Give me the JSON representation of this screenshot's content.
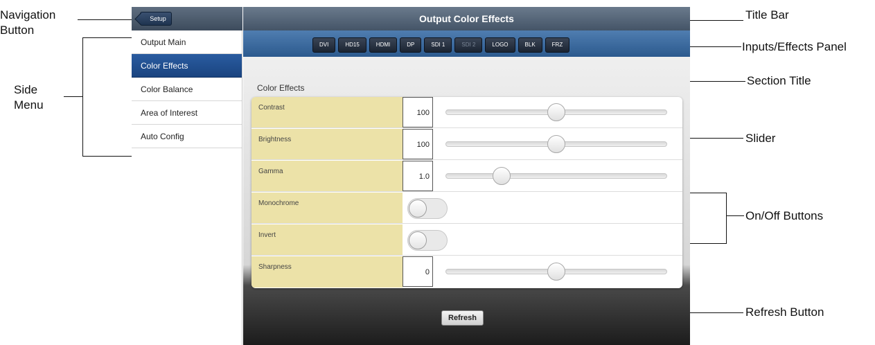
{
  "app": {
    "nav_button": "Setup",
    "title": "Output Color Effects"
  },
  "sidebar": {
    "items": [
      {
        "label": "Output Main",
        "active": false
      },
      {
        "label": "Color Effects",
        "active": true
      },
      {
        "label": "Color Balance",
        "active": false
      },
      {
        "label": "Area of Interest",
        "active": false
      },
      {
        "label": "Auto Config",
        "active": false
      }
    ]
  },
  "tabs": [
    {
      "label": "DVI",
      "enabled": true
    },
    {
      "label": "HD15",
      "enabled": true
    },
    {
      "label": "HDMI",
      "enabled": true
    },
    {
      "label": "DP",
      "enabled": true
    },
    {
      "label": "SDI 1",
      "enabled": true
    },
    {
      "label": "SDI 2",
      "enabled": false
    },
    {
      "label": "LOGO",
      "enabled": true
    },
    {
      "label": "BLK",
      "enabled": true
    },
    {
      "label": "FRZ",
      "enabled": true
    }
  ],
  "section": {
    "title": "Color Effects",
    "rows": [
      {
        "label": "Contrast",
        "kind": "slider",
        "value": "100",
        "level": 0.5
      },
      {
        "label": "Brightness",
        "kind": "slider",
        "value": "100",
        "level": 0.5
      },
      {
        "label": "Gamma",
        "kind": "slider",
        "value": "1.0",
        "level": 0.25
      },
      {
        "label": "Monochrome",
        "kind": "toggle",
        "on": false
      },
      {
        "label": "Invert",
        "kind": "toggle",
        "on": false
      },
      {
        "label": "Sharpness",
        "kind": "slider",
        "value": "0",
        "level": 0.5
      }
    ],
    "refresh_label": "Refresh"
  },
  "callouts": {
    "nav_line1": "Navigation",
    "nav_line2": "Button",
    "side_line1": "Side",
    "side_line2": "Menu",
    "title_bar": "Title Bar",
    "inputs_panel": "Inputs/Effects Panel",
    "section_title": "Section Title",
    "slider": "Slider",
    "onoff": "On/Off Buttons",
    "refresh": "Refresh Button"
  },
  "colors": {
    "active_menu": "#1a4480",
    "label_bg": "#ece2a8"
  }
}
